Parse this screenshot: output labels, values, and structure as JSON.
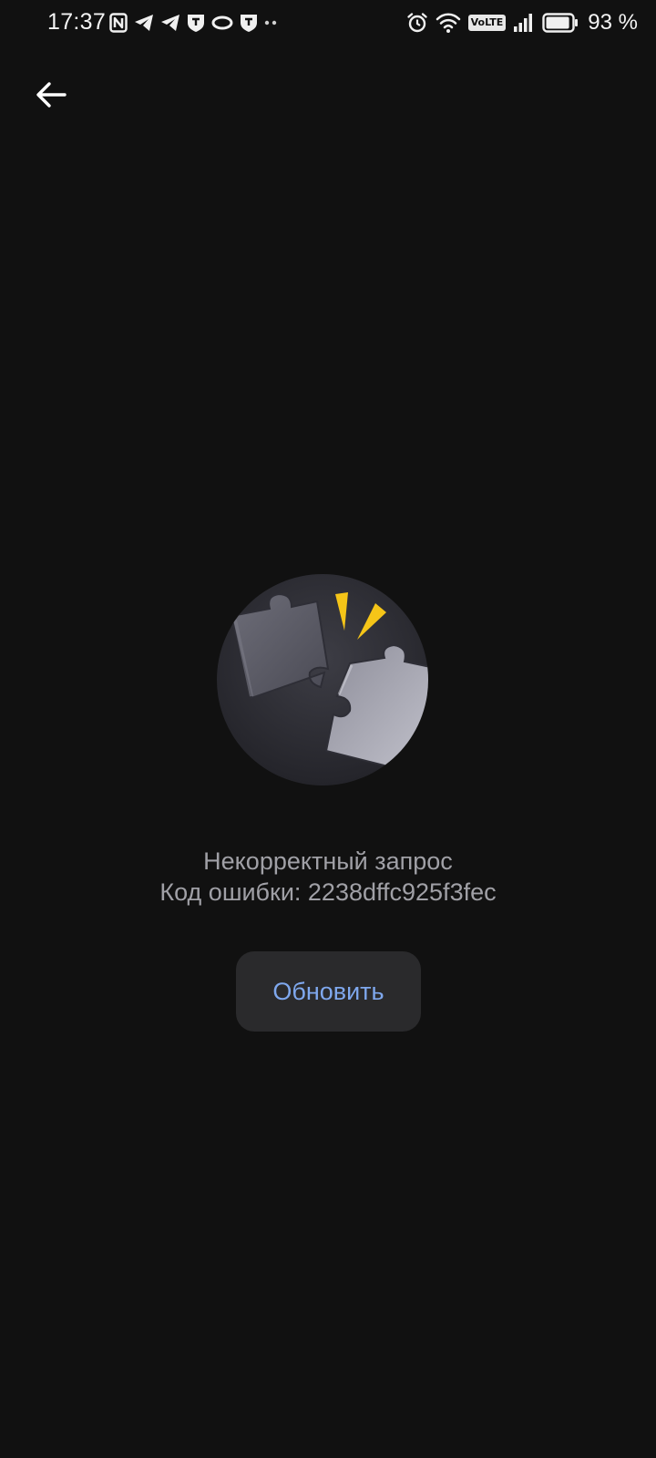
{
  "status_bar": {
    "time": "17:37",
    "left_icons": [
      "nfc-icon",
      "telegram-icon",
      "telegram-icon",
      "tinkoff-icon",
      "ring-icon",
      "tinkoff-icon",
      "more-dots-icon"
    ],
    "right_icons": [
      "alarm-icon",
      "wifi-icon",
      "volte-badge",
      "signal-icon",
      "battery-icon"
    ],
    "volte_label": "VoLTE",
    "battery_text": "93 %",
    "battery_level": 0.93
  },
  "header": {
    "back_icon": "arrow-left-icon"
  },
  "illustration": {
    "name": "broken-puzzle-illustration",
    "accent_color": "#f5c518"
  },
  "error": {
    "title": "Некорректный запрос",
    "code_line": "Код ошибки: 2238dffc925f3fec"
  },
  "actions": {
    "refresh_label": "Обновить",
    "refresh_color": "#7fa8ee"
  },
  "colors": {
    "background": "#111111",
    "button_bg": "#2a2a2c",
    "text_secondary": "#a0a0a6"
  }
}
